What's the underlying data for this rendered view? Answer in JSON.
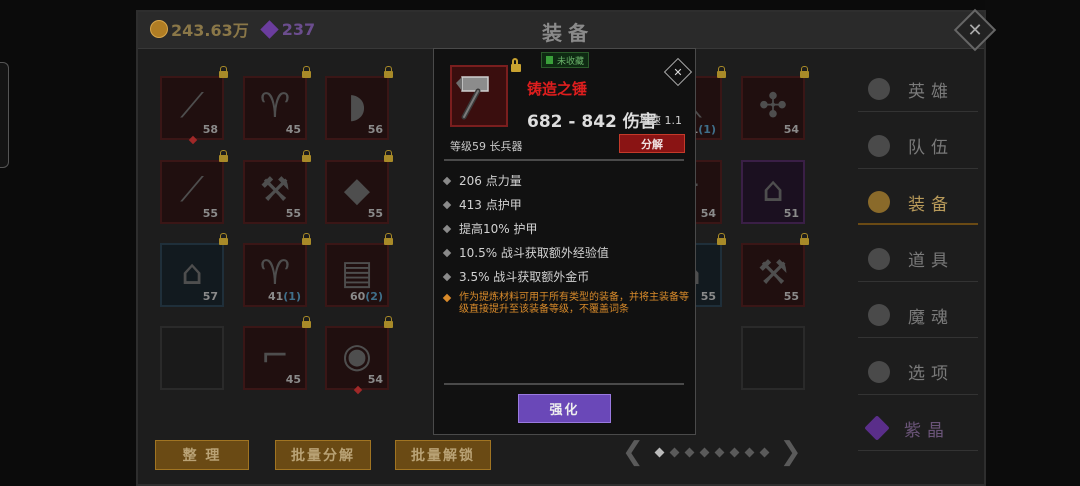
{
  "currency": {
    "gold": "243.63万",
    "gems": "237"
  },
  "panel": {
    "title": "装备",
    "close_glyph": "✕"
  },
  "inventory": [
    {
      "level": "58",
      "rarity": "red",
      "icon": "spear-icon",
      "locked": true,
      "marked": true
    },
    {
      "level": "45",
      "rarity": "red",
      "icon": "robe-icon",
      "locked": true,
      "marked": false
    },
    {
      "level": "56",
      "rarity": "red",
      "icon": "axe-blade-icon",
      "locked": true,
      "marked": false
    },
    {
      "level": "55",
      "rarity": "red",
      "icon": "trident-icon",
      "locked": true,
      "marked": false
    },
    {
      "level": "55",
      "rarity": "red",
      "icon": "hammer-icon",
      "locked": true,
      "marked": false
    },
    {
      "level": "55",
      "rarity": "red",
      "icon": "helmet-icon",
      "locked": true,
      "marked": false
    },
    {
      "level": "57",
      "rarity": "blue",
      "icon": "hood-icon",
      "locked": true,
      "marked": false
    },
    {
      "level": "41",
      "extra": "(1)",
      "rarity": "red",
      "icon": "coat-icon",
      "locked": true,
      "marked": false
    },
    {
      "level": "60",
      "extra": "(2)",
      "rarity": "red",
      "icon": "armor-icon",
      "locked": true,
      "marked": false
    },
    {
      "level": "45",
      "rarity": "red",
      "icon": "boots-icon",
      "locked": true,
      "marked": false
    },
    {
      "level": "54",
      "rarity": "red",
      "icon": "shield-icon",
      "locked": true,
      "marked": true
    },
    {
      "level": "51",
      "extra": "(1)",
      "rarity": "red",
      "icon": "staff-icon",
      "locked": true,
      "marked": false
    },
    {
      "level": "54",
      "rarity": "red",
      "icon": "mace-icon",
      "locked": true,
      "marked": false
    },
    {
      "level": "54",
      "rarity": "red",
      "icon": "dagger-icon",
      "locked": false,
      "marked": false
    },
    {
      "level": "51",
      "rarity": "purple",
      "icon": "hood-icon",
      "locked": false,
      "marked": false
    },
    {
      "level": "55",
      "rarity": "blue",
      "icon": "cloak-icon",
      "locked": true,
      "marked": false
    },
    {
      "level": "55",
      "rarity": "red",
      "icon": "axe-icon",
      "locked": true,
      "marked": false
    }
  ],
  "nav": [
    {
      "label": "英雄",
      "icon": "heroes-icon"
    },
    {
      "label": "队伍",
      "icon": "flag-icon"
    },
    {
      "label": "装备",
      "icon": "helmet-icon",
      "active": true
    },
    {
      "label": "道具",
      "icon": "bag-icon"
    },
    {
      "label": "魔魂",
      "icon": "flame-icon"
    },
    {
      "label": "选项",
      "icon": "gear-icon"
    },
    {
      "label": "紫晶",
      "icon": "crystal-icon"
    }
  ],
  "buttons": {
    "sort": "整 理",
    "batch_dismantle": "批量分解",
    "batch_unlock": "批量解锁"
  },
  "pager": {
    "prev": "❮",
    "next": "❯",
    "pages": 8,
    "current": 1
  },
  "popup": {
    "favorite": "未收藏",
    "name": "铸造之锤",
    "damage": "682 - 842 伤害",
    "attack_speed": "攻速 1.1",
    "level_type": "等级59 长兵器",
    "dismantle": "分解",
    "close_glyph": "✕",
    "stats": [
      "206 点力量",
      "413 点护甲",
      "提高10% 护甲",
      "10.5% 战斗获取额外经验值",
      "3.5% 战斗获取额外金币"
    ],
    "note": "作为提炼材料可用于所有类型的装备，并将主装备等级直接提升至该装备等级，不覆盖词条",
    "enhance": "强化"
  },
  "colors": {
    "rare_red": "#e01e1e",
    "gold": "#b07d24",
    "violet": "#6a48b8",
    "note_orange": "#d88a2a"
  }
}
